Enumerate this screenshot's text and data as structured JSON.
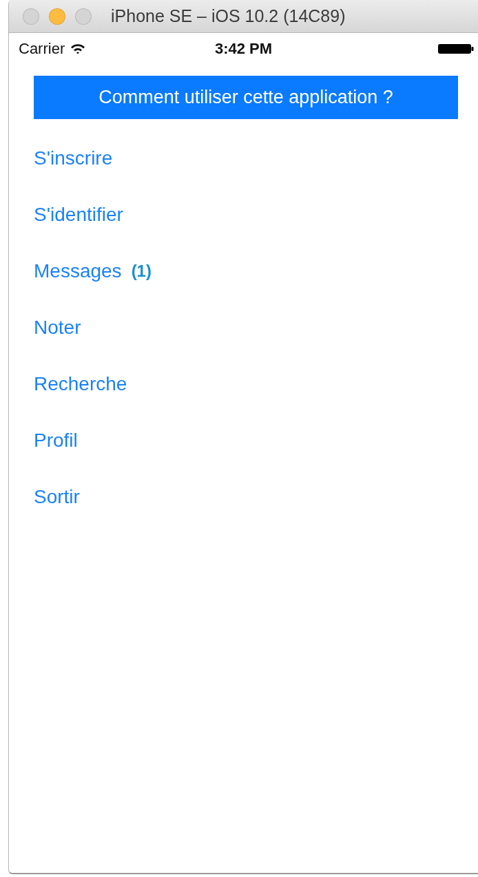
{
  "window": {
    "title": "iPhone SE – iOS 10.2 (14C89)",
    "buttons": [
      {
        "kind": "close",
        "active": false
      },
      {
        "kind": "minimize",
        "active": true
      },
      {
        "kind": "zoom",
        "active": false
      }
    ]
  },
  "status_bar": {
    "carrier": "Carrier",
    "time": "3:42 PM"
  },
  "help_button": {
    "label": "Comment utiliser cette application ?"
  },
  "menu": [
    {
      "label": "S'inscrire"
    },
    {
      "label": "S'identifier"
    },
    {
      "label": "Messages",
      "badge": "(1)"
    },
    {
      "label": "Noter"
    },
    {
      "label": "Recherche"
    },
    {
      "label": "Profil"
    },
    {
      "label": "Sortir"
    }
  ]
}
